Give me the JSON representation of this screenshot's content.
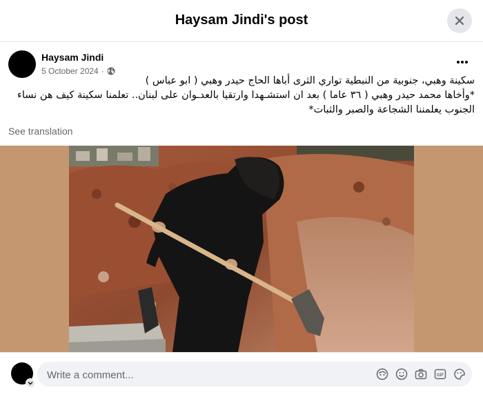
{
  "dialog": {
    "title": "Haysam Jindi's post",
    "close_icon": "close-icon"
  },
  "post": {
    "author": "Haysam Jindi",
    "date": "5 October 2024",
    "separator": "·",
    "privacy_icon": "globe-icon",
    "more_icon": "more-horizontal-icon",
    "text_lines": [
      "سكينة وهبي، جنوبية من النبطية تواري الثرى أباها الحاج حيدر وهبي ( ابو عباس )",
      "*وأخاها محمد حيدر وهبي ( ٣٦ عاما ) بعد ان استشـهدا وارتقيا بالعدـوان على لبنان.. تعلمنا سكينة كيف هن نساء",
      "الجنوب يعلمننا الشجاعة والصبر والثبات*"
    ],
    "see_translation": "See translation"
  },
  "comment": {
    "placeholder": "Write a comment...",
    "tools": [
      "avatar-sticker-icon",
      "emoji-icon",
      "camera-icon",
      "gif-icon",
      "sticker-icon"
    ],
    "gif_label": "GIF"
  },
  "colors": {
    "media_background": "#c49770",
    "divider": "#e4e6eb",
    "secondary_text": "#65676b",
    "input_background": "#f0f2f5"
  }
}
